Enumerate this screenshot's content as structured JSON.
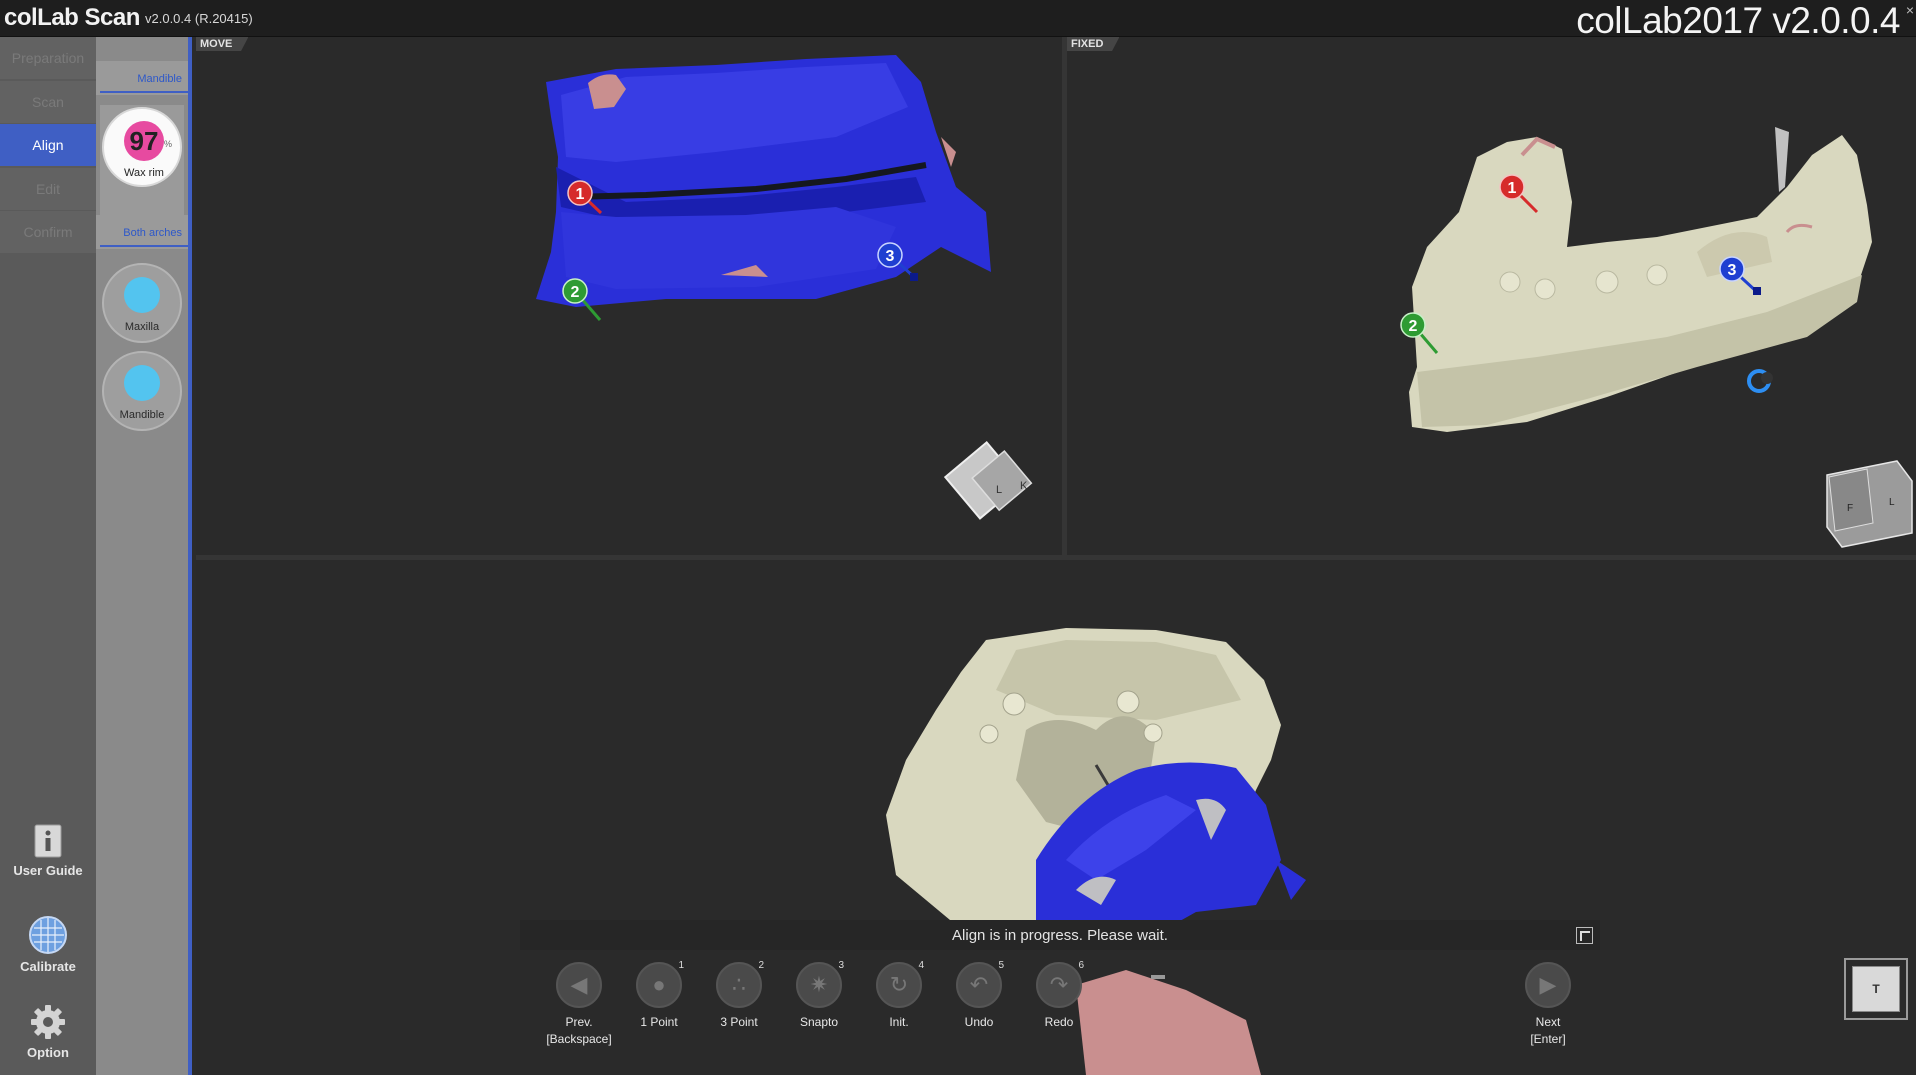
{
  "titlebar": {
    "app_name": "colLab Scan",
    "app_version": "v2.0.0.4 (R.20415)",
    "big_version": "colLab2017 v2.0.0.4",
    "close_glyph": "×"
  },
  "steps": [
    {
      "label": "Preparation",
      "active": false
    },
    {
      "label": "Scan",
      "active": false
    },
    {
      "label": "Align",
      "active": true
    },
    {
      "label": "Edit",
      "active": false
    },
    {
      "label": "Confirm",
      "active": false
    }
  ],
  "tools": {
    "user_guide": "User Guide",
    "calibrate": "Calibrate",
    "option": "Option"
  },
  "subpanel": {
    "mandible_header": "Mandible",
    "wax_rim_value": "97",
    "wax_rim_pct": "%",
    "wax_rim_label": "Wax rim",
    "both_arches_header": "Both arches",
    "maxilla_label": "Maxilla",
    "mandible_label": "Mandible"
  },
  "viewports": {
    "move_label": "MOVE",
    "fixed_label": "FIXED",
    "markers": [
      "1",
      "2",
      "3"
    ],
    "cube_move": [
      "L",
      "K"
    ],
    "cube_fixed": [
      "F",
      "L"
    ]
  },
  "status": {
    "message": "Align is in progress. Please wait."
  },
  "toolbar": {
    "prev": "Prev.",
    "prev_key": "[Backspace]",
    "one_point": "1 Point",
    "one_point_key": "1",
    "three_point": "3 Point",
    "three_point_key": "2",
    "snapto": "Snapto",
    "snapto_key": "3",
    "init": "Init.",
    "init_key": "4",
    "undo": "Undo",
    "undo_key": "5",
    "redo": "Redo",
    "redo_key": "6",
    "next": "Next",
    "next_key": "[Enter]",
    "view_label": "T"
  },
  "colors": {
    "accent": "#3f5fc4",
    "marker_red": "#d62b2b",
    "marker_green": "#2e9b33",
    "marker_blue": "#1f3fd1",
    "mesh_blue": "#2a2fd8",
    "mesh_bone": "#d9d8bf"
  }
}
